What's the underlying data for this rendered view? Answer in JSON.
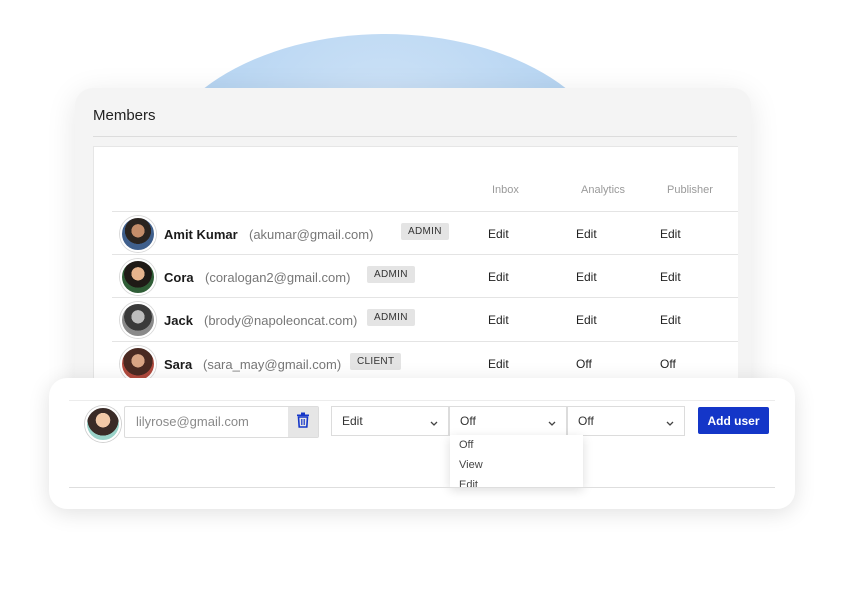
{
  "colors": {
    "accent": "#1436c8",
    "role_badge_bg": "#e4e4e4",
    "card_bg": "#f4f4f4"
  },
  "members": {
    "title": "Members",
    "columns": [
      "Inbox",
      "Analytics",
      "Publisher"
    ],
    "rows": [
      {
        "name": "Amit Kumar",
        "email": "(akumar@gmail.com)",
        "role": "ADMIN",
        "inbox": "Edit",
        "analytics": "Edit",
        "publisher": "Edit"
      },
      {
        "name": "Cora",
        "email": "(coralogan2@gmail.com)",
        "role": "ADMIN",
        "inbox": "Edit",
        "analytics": "Edit",
        "publisher": "Edit"
      },
      {
        "name": "Jack",
        "email": "(brody@napoleoncat.com)",
        "role": "ADMIN",
        "inbox": "Edit",
        "analytics": "Edit",
        "publisher": "Edit"
      },
      {
        "name": "Sara",
        "email": "(sara_may@gmail.com)",
        "role": "CLIENT",
        "inbox": "Edit",
        "analytics": "Off",
        "publisher": "Off"
      }
    ]
  },
  "add_user": {
    "email_placeholder": "lilyrose@gmail.com",
    "trash_icon": "trash-icon",
    "inbox_select": "Edit",
    "analytics_select": "Off",
    "publisher_select": "Off",
    "button_label": "Add user",
    "dropdown_options": [
      "Off",
      "View",
      "Edit"
    ]
  }
}
